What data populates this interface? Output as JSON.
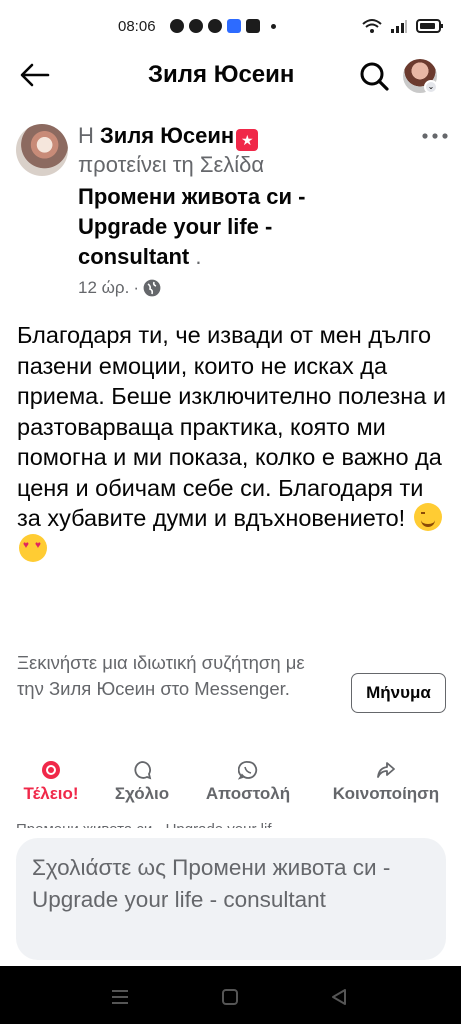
{
  "status_bar": {
    "time": "08:06"
  },
  "header": {
    "title": "Зиля Юсеин"
  },
  "post": {
    "prefix": "Η",
    "author": "Зиля Юсеин",
    "recommends_text": "προτείνει τη Σελίδα",
    "page_name": "Промени живота си - Upgrade your life - consultant",
    "page_name_suffix": ".",
    "time": "12 ώρ.",
    "meta_separator": "·",
    "body": "Благодаря ти, че извади от мен дълго пазени емоции, които не исках да приема. Беше изключително полезна и разтоварваща практика, която ми помогна и ми показа, колко е важно да ценя и обичам себе си. Благодаря ти за хубавите думи и вдъхновението!"
  },
  "messenger": {
    "prompt": "Ξεκινήστε μια ιδιωτική συζήτηση με την Зиля Юсеин στο Messenger.",
    "button_label": "Μήνυμα"
  },
  "actions": {
    "like": "Τέλειο!",
    "comment": "Σχόλιο",
    "send": "Αποστολή",
    "share": "Κοινοποίηση"
  },
  "peek_text": "Промени живота си - Upgrade your lif",
  "comment_box": {
    "placeholder": "Σχολιάστε ως Промени живота си - Upgrade your life - consultant"
  },
  "colors": {
    "accent_red": "#f02849",
    "secondary_text": "#65676b",
    "input_bg": "#f0f2f5"
  }
}
